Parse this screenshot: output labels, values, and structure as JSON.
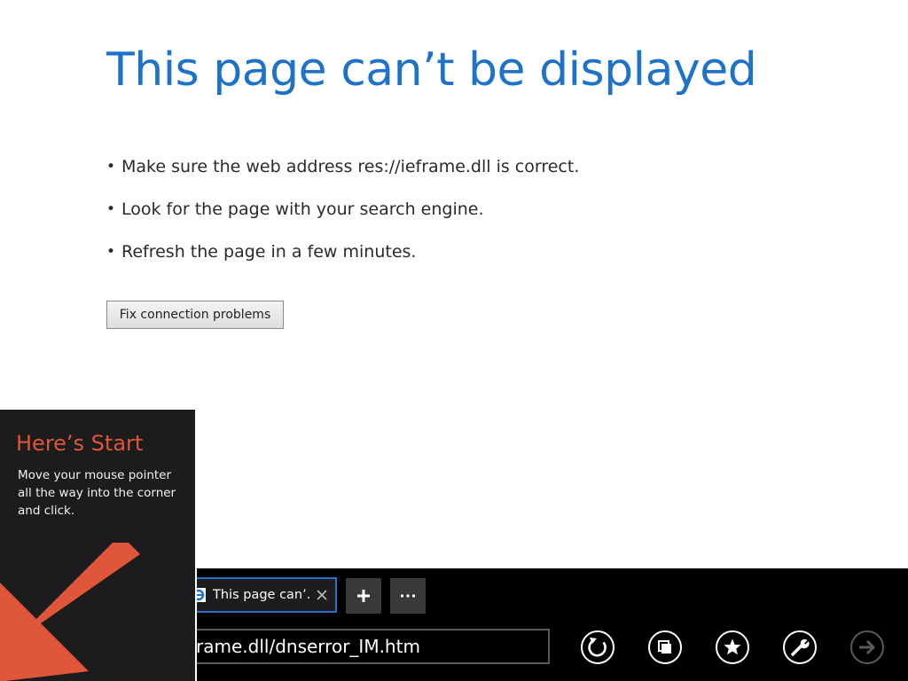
{
  "error_page": {
    "title": "This page can’t be displayed",
    "suggestions": [
      "Make sure the web address res://ieframe.dll is correct.",
      "Look for the page with your search engine.",
      "Refresh the page in a few minutes."
    ],
    "bullet": "•",
    "fix_button_label": "Fix connection problems",
    "title_color": "#1e73c8"
  },
  "start_tip": {
    "title": "Here’s Start",
    "body": "Move your mouse pointer all the way into the corner and click.",
    "accent_color": "#e0563a",
    "arrow_icon": "arrow-down-left-icon"
  },
  "app_bar": {
    "tab": {
      "title": "This page can’...",
      "favicon": "ie-favicon-icon",
      "close_icon": "close-icon"
    },
    "new_tab_icon": "plus-icon",
    "tab_tools_icon": "ellipsis-icon",
    "address": "frame.dll/dnserror_IM.htm",
    "buttons": [
      {
        "name": "refresh",
        "icon": "refresh-icon"
      },
      {
        "name": "tabs",
        "icon": "pin-tabs-icon"
      },
      {
        "name": "favorites",
        "icon": "star-icon"
      },
      {
        "name": "page-tools",
        "icon": "wrench-icon"
      },
      {
        "name": "forward",
        "icon": "forward-arrow-icon",
        "enabled": false
      }
    ],
    "tab_border_color": "#2f6fd0"
  }
}
